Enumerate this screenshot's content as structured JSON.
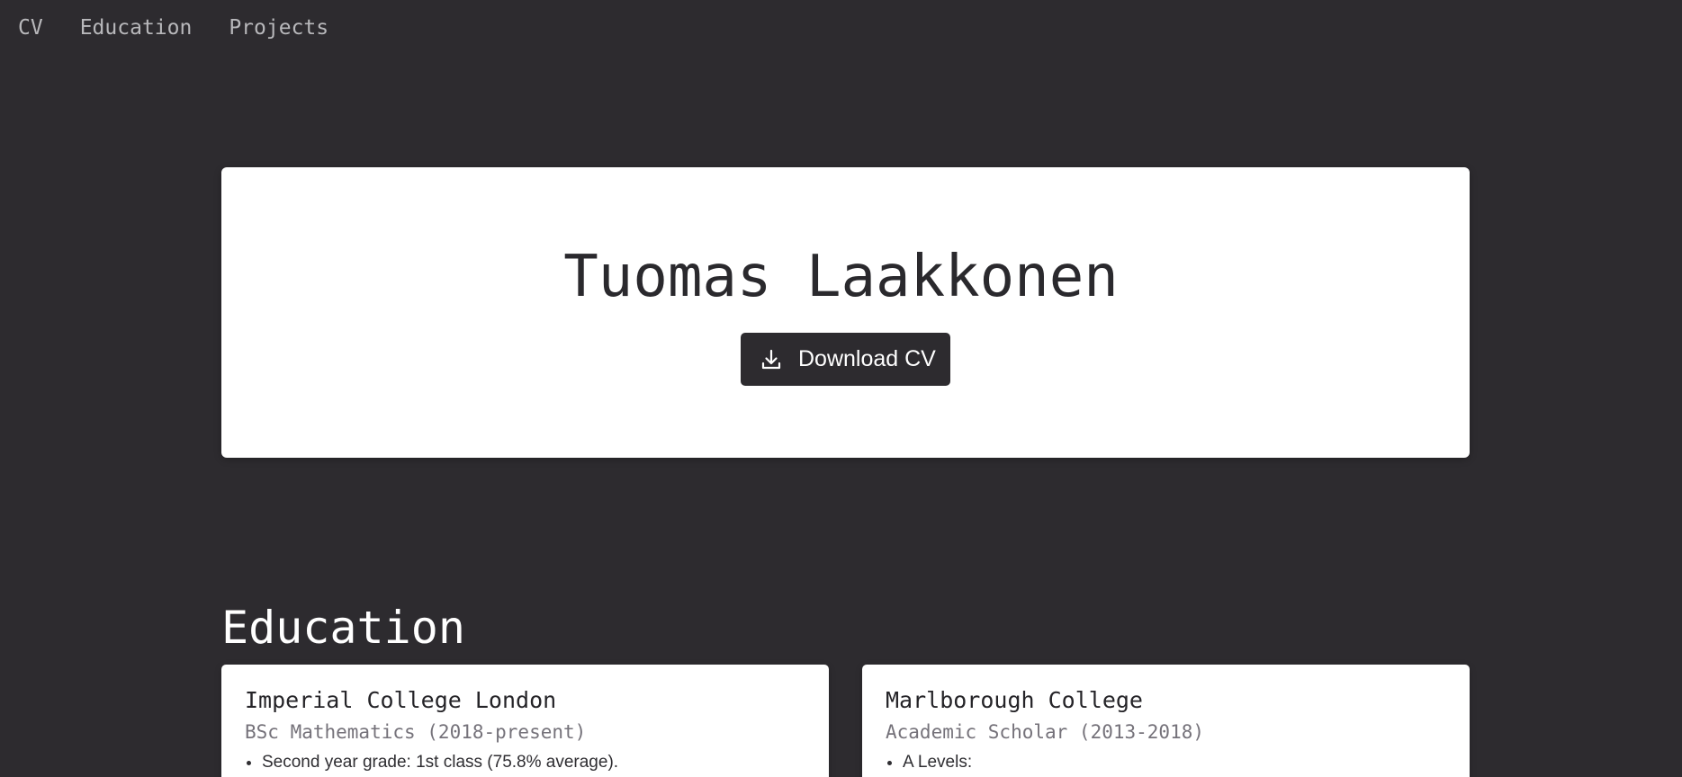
{
  "nav": {
    "items": [
      {
        "label": "CV"
      },
      {
        "label": "Education"
      },
      {
        "label": "Projects"
      }
    ]
  },
  "hero": {
    "name": "Tuomas Laakkonen",
    "download_label": "Download CV",
    "download_icon": "download-icon"
  },
  "education": {
    "title": "Education",
    "cards": [
      {
        "school": "Imperial College London",
        "program": "BSc Mathematics (2018-present)",
        "bullets": [
          "Second year grade: 1st class (75.8% average)."
        ]
      },
      {
        "school": "Marlborough College",
        "program": "Academic Scholar (2013-2018)",
        "bullets": [
          "A Levels:"
        ]
      }
    ]
  },
  "colors": {
    "background": "#2d2b2f",
    "card": "#ffffff",
    "nav_text": "#b8b8bb",
    "muted_text": "#75727a"
  }
}
